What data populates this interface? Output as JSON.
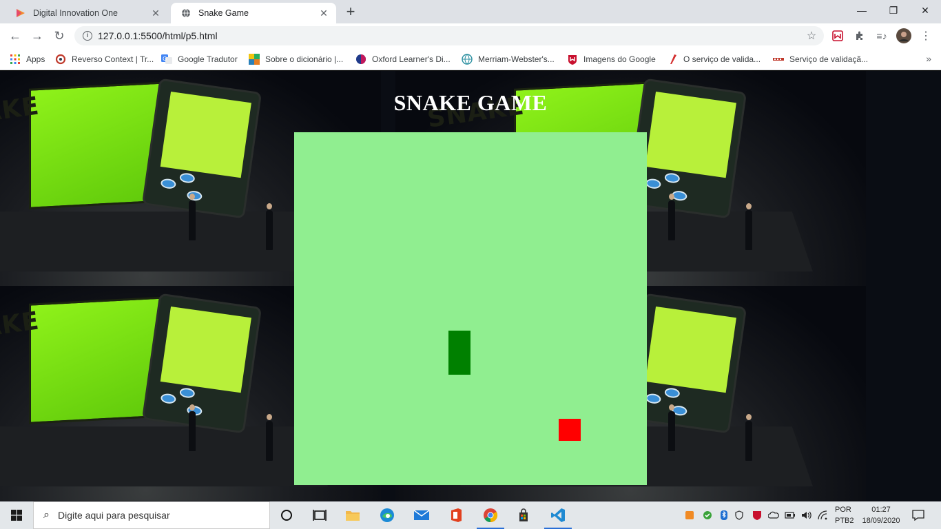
{
  "browser": {
    "tabs": [
      {
        "title": "Digital Innovation One",
        "favicon": "dio-logo-icon",
        "active": false
      },
      {
        "title": "Snake Game",
        "favicon": "globe-icon",
        "active": true
      }
    ],
    "url": "127.0.0.1:5500/html/p5.html",
    "bookmarks": [
      {
        "label": "Apps",
        "icon": "apps-grid-icon"
      },
      {
        "label": "Reverso Context | Tr...",
        "icon": "reverso-icon"
      },
      {
        "label": "Google Tradutor",
        "icon": "google-translate-icon"
      },
      {
        "label": "Sobre o dicionário |...",
        "icon": "dicionario-icon"
      },
      {
        "label": "Oxford Learner's Di...",
        "icon": "oxford-icon"
      },
      {
        "label": "Merriam-Webster's...",
        "icon": "globe-icon"
      },
      {
        "label": "Imagens do Google",
        "icon": "mcafee-icon"
      },
      {
        "label": "O serviço de valida...",
        "icon": "pen-icon"
      },
      {
        "label": "Serviço de validaçã...",
        "icon": "validator-icon"
      }
    ]
  },
  "game": {
    "title": "SNAKE GAME",
    "board_color": "#90ee90",
    "snake_color": "#008000",
    "food_color": "#ff0000"
  },
  "taskbar": {
    "search_placeholder": "Digite aqui para pesquisar",
    "language_top": "POR",
    "language_bottom": "PTB2",
    "time": "01:27",
    "date": "18/09/2020"
  }
}
